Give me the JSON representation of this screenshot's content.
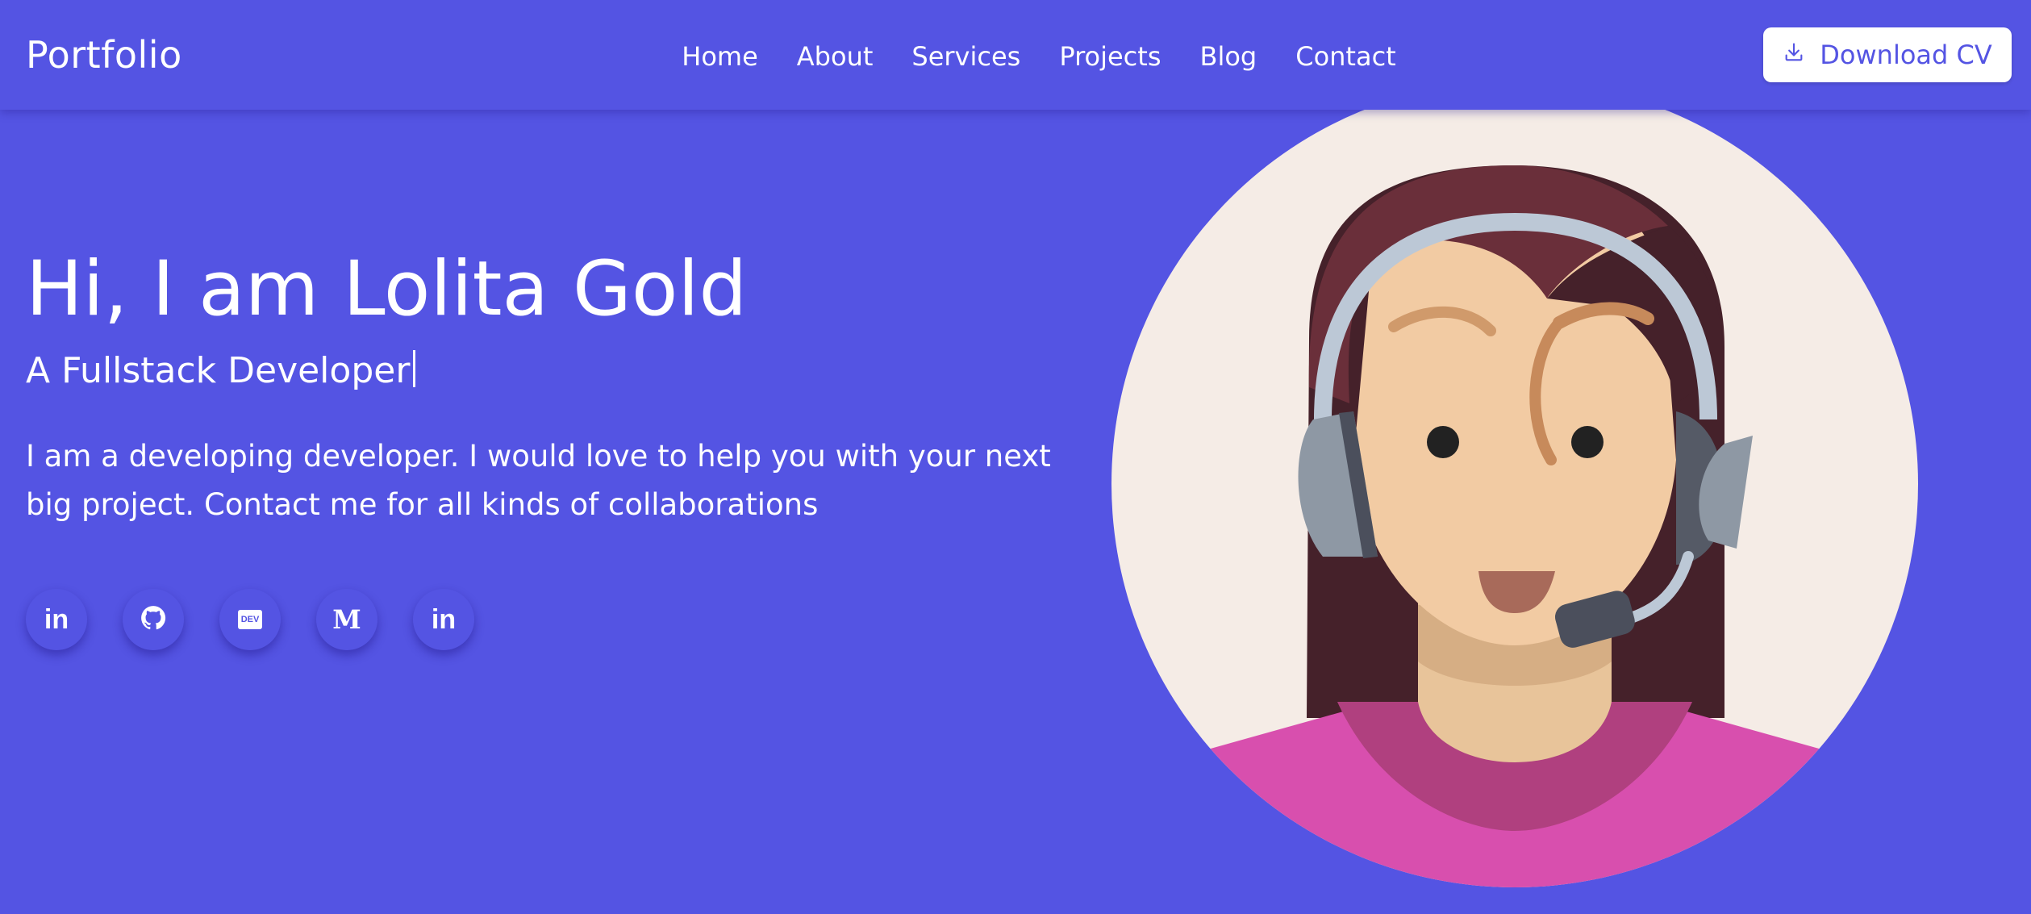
{
  "brand": {
    "logo": "Portfolio"
  },
  "nav": {
    "links": [
      "Home",
      "About",
      "Services",
      "Projects",
      "Blog",
      "Contact"
    ],
    "download_label": "Download CV"
  },
  "hero": {
    "title": "Hi, I am Lolita Gold",
    "subtitle": "A Fullstack Developer",
    "description": "I am a developing developer. I would love to help you with your next big project. Contact me for all kinds of collaborations"
  },
  "socials": [
    {
      "icon": "linkedin-icon",
      "glyph": "in"
    },
    {
      "icon": "github-icon",
      "glyph": ""
    },
    {
      "icon": "dev-icon",
      "glyph": "DEV"
    },
    {
      "icon": "medium-icon",
      "glyph": "M"
    },
    {
      "icon": "linkedin-icon",
      "glyph": "in"
    }
  ],
  "colors": {
    "background": "#5454e3",
    "button_bg": "#ffffff",
    "button_text": "#5454e3",
    "avatar_bg": "#f5ece6",
    "shirt": "#d84fae"
  }
}
